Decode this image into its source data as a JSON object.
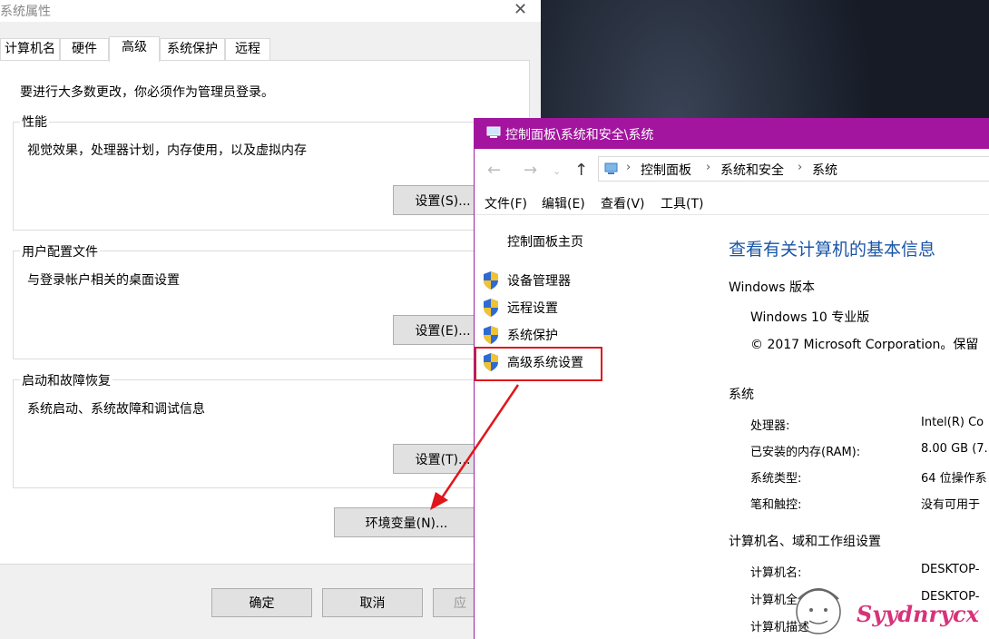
{
  "sysprop": {
    "title": "系统属性",
    "tabs": [
      "计算机名",
      "硬件",
      "高级",
      "系统保护",
      "远程"
    ],
    "notice": "要进行大多数更改，你必须作为管理员登录。",
    "performance": {
      "title": "性能",
      "desc": "视觉效果，处理器计划，内存使用，以及虚拟内存",
      "button": "设置(S)..."
    },
    "profiles": {
      "title": "用户配置文件",
      "desc": "与登录帐户相关的桌面设置",
      "button": "设置(E)..."
    },
    "startup": {
      "title": "启动和故障恢复",
      "desc": "系统启动、系统故障和调试信息",
      "button": "设置(T)..."
    },
    "env_button": "环境变量(N)...",
    "footer": {
      "ok": "确定",
      "cancel": "取消",
      "apply": "应"
    }
  },
  "cp": {
    "title": "控制面板\\系统和安全\\系统",
    "address": [
      "控制面板",
      "系统和安全",
      "系统"
    ],
    "menu": [
      "文件(F)",
      "编辑(E)",
      "查看(V)",
      "工具(T)"
    ],
    "sidebar": {
      "home": "控制面板主页",
      "links": [
        "设备管理器",
        "远程设置",
        "系统保护",
        "高级系统设置"
      ]
    },
    "main": {
      "title": "查看有关计算机的基本信息",
      "edition_head": "Windows 版本",
      "edition": "Windows 10 专业版",
      "copyright": "© 2017 Microsoft Corporation。保留",
      "system_head": "系统",
      "system": [
        {
          "key": "处理器:",
          "value": "Intel(R) Co"
        },
        {
          "key": "已安装的内存(RAM):",
          "value": "8.00 GB (7."
        },
        {
          "key": "系统类型:",
          "value": "64 位操作系"
        },
        {
          "key": "笔和触控:",
          "value": "没有可用于"
        }
      ],
      "computer_head": "计算机名、域和工作组设置",
      "computer": [
        {
          "key": "计算机名:",
          "value": "DESKTOP-"
        },
        {
          "key": "计算机全",
          "value": "DESKTOP-"
        },
        {
          "key": "计算机描述",
          "value": ""
        }
      ]
    }
  },
  "watermark": "Syydnrycx",
  "colors": {
    "titlebar": "#a3159f",
    "link_blue": "#1a56a6",
    "highlight_red": "#e0161b"
  }
}
